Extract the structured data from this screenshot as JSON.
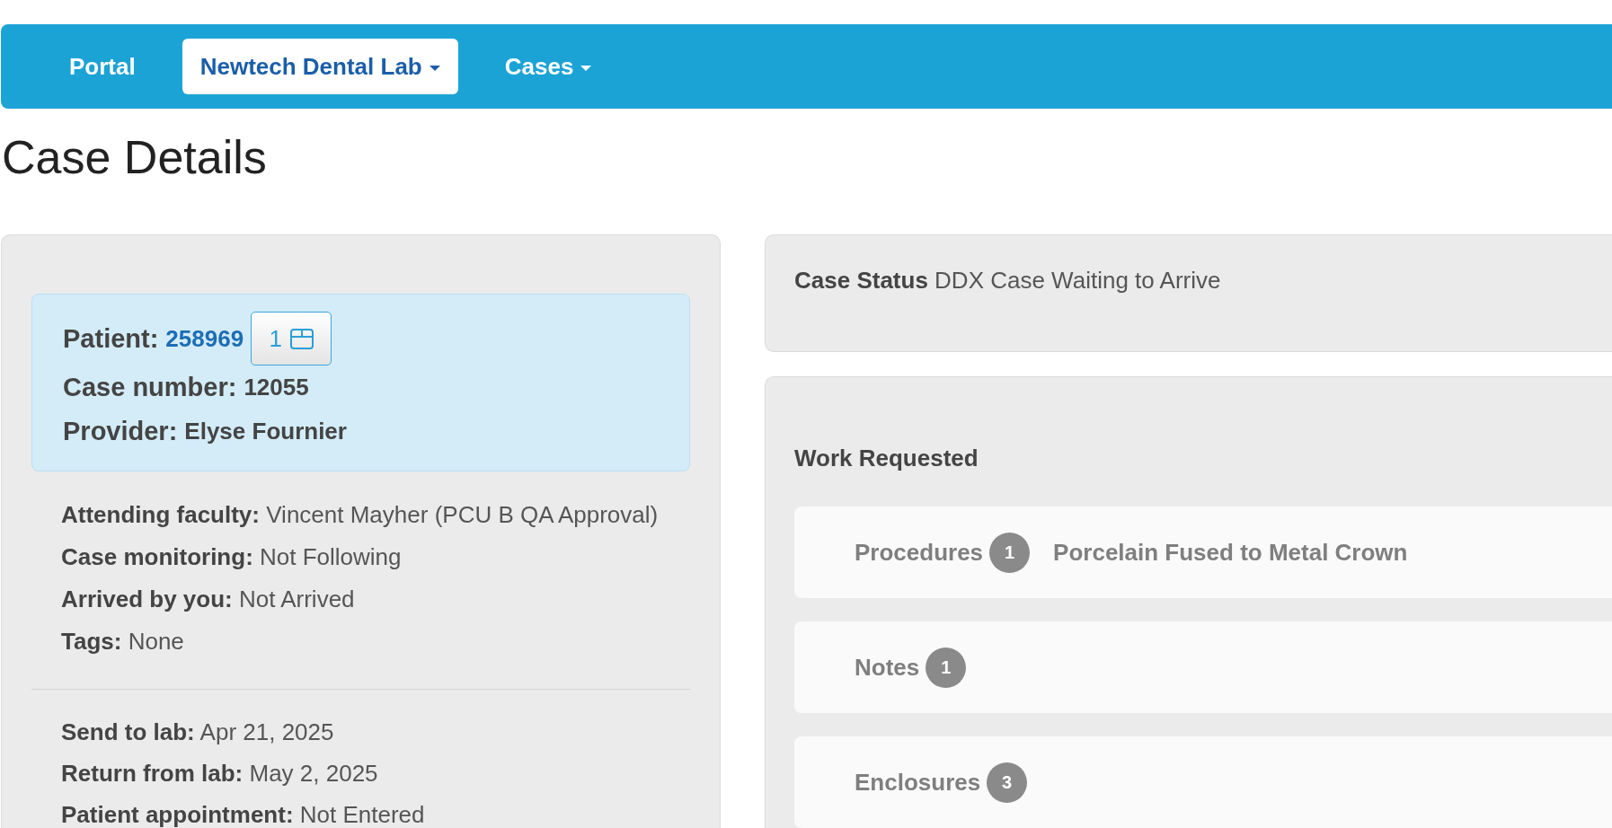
{
  "nav": {
    "items": [
      {
        "label": "Portal",
        "selected": false,
        "dropdown": false
      },
      {
        "label": "Newtech Dental Lab",
        "selected": true,
        "dropdown": true
      },
      {
        "label": "Cases",
        "selected": false,
        "dropdown": true
      }
    ]
  },
  "page_title": "Case Details",
  "case_summary": {
    "patient": {
      "label": "Patient:",
      "value": "258969",
      "button_label": "1"
    },
    "fields": [
      {
        "label": "Case number:",
        "value": "12055"
      },
      {
        "label": "Provider:",
        "value": "Elyse Fournier"
      }
    ]
  },
  "details": [
    {
      "label": "Attending faculty:",
      "value": "Vincent Mayher (PCU B QA Approval)"
    },
    {
      "label": "Case monitoring:",
      "value": "Not Following"
    },
    {
      "label": "Arrived by you:",
      "value": "Not Arrived"
    },
    {
      "label": "Tags:",
      "value": "None"
    }
  ],
  "dates": [
    {
      "label": "Send to lab:",
      "value": "Apr 21, 2025"
    },
    {
      "label": "Return from lab:",
      "value": "May 2, 2025"
    },
    {
      "label": "Patient appointment:",
      "value": "Not Entered"
    }
  ],
  "case_status": {
    "label": "Case Status",
    "value": "DDX Case Waiting to Arrive"
  },
  "work_requested": {
    "title": "Work Requested",
    "sections": [
      {
        "label": "Procedures",
        "count": "1",
        "summary": "Porcelain Fused to Metal Crown"
      },
      {
        "label": "Notes",
        "count": "1"
      },
      {
        "label": "Enclosures",
        "count": "3"
      }
    ]
  }
}
